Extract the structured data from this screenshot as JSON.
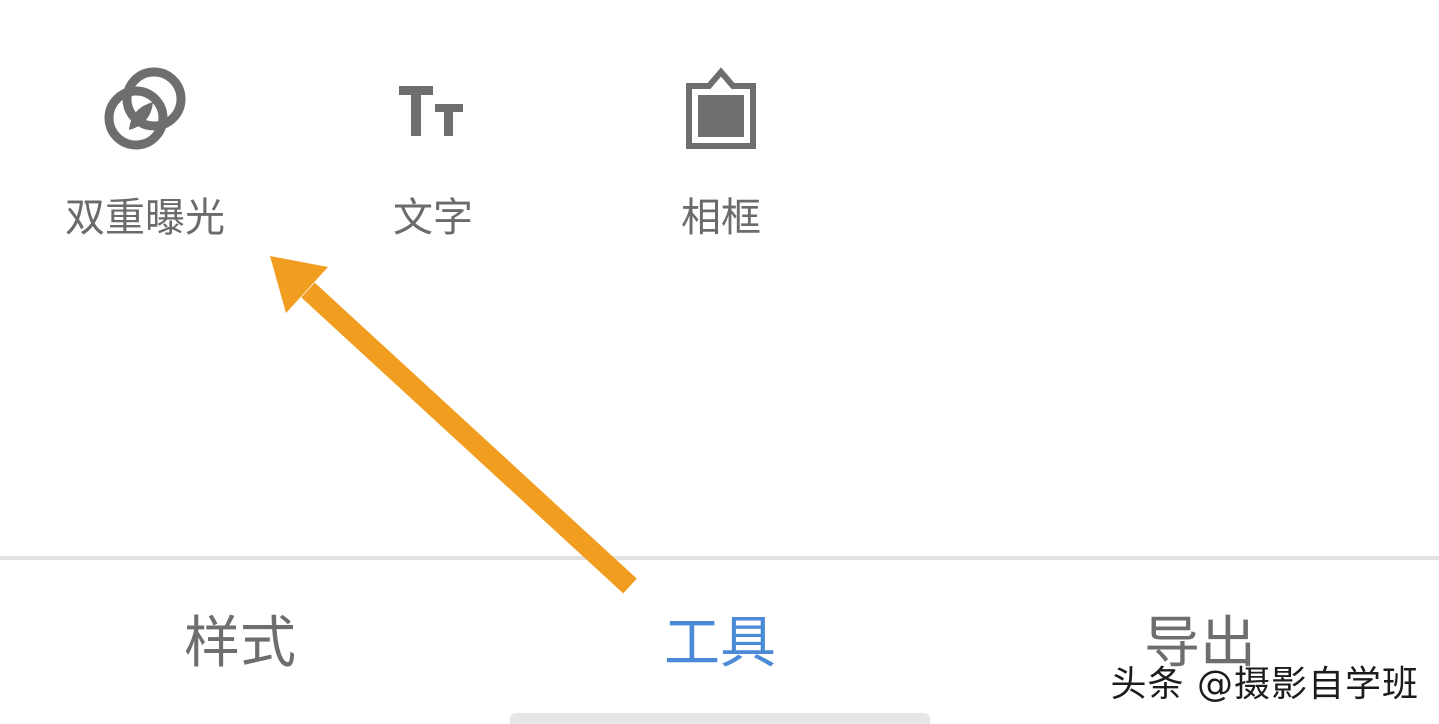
{
  "tools": [
    {
      "label": "双重曝光",
      "icon": "double-exposure-icon"
    },
    {
      "label": "文字",
      "icon": "text-icon"
    },
    {
      "label": "相框",
      "icon": "frame-icon"
    }
  ],
  "tabs": [
    {
      "label": "样式",
      "active": false
    },
    {
      "label": "工具",
      "active": true
    },
    {
      "label": "导出",
      "active": false
    }
  ],
  "text_icon_glyph": "Tт",
  "watermark": "头条 @摄影自学班",
  "colors": {
    "icon": "#6e6e6e",
    "label": "#6b6b6b",
    "active_tab": "#4b8ad6",
    "arrow": "#f19d20",
    "divider": "#e2e2e2"
  }
}
